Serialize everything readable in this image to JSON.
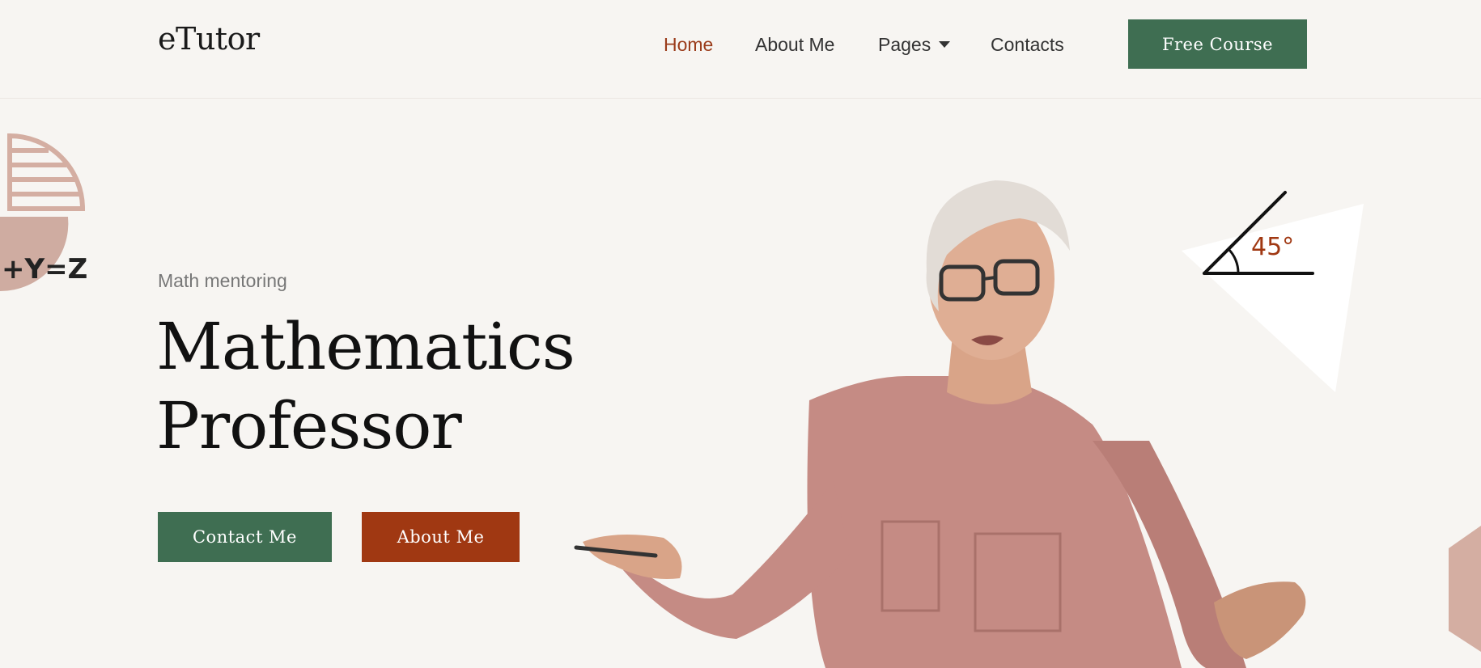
{
  "brand": {
    "logo_text": "eTutor"
  },
  "nav": {
    "items": [
      {
        "label": "Home",
        "active": true
      },
      {
        "label": "About Me",
        "active": false
      },
      {
        "label": "Pages",
        "active": false,
        "has_dropdown": true
      },
      {
        "label": "Contacts",
        "active": false
      }
    ],
    "cta_label": "Free Course"
  },
  "hero": {
    "eyebrow": "Math mentoring",
    "headline_line1": "Mathematics",
    "headline_line2": "Professor",
    "primary_button": "Contact Me",
    "secondary_button": "About Me"
  },
  "decorations": {
    "equation_text": "+Y=Z",
    "angle_label": "45°"
  },
  "colors": {
    "background": "#f7f5f2",
    "accent_green": "#3f6e52",
    "accent_rust": "#a03812",
    "active_nav": "#9b3c1b",
    "deco_pink": "#d4aea2"
  }
}
